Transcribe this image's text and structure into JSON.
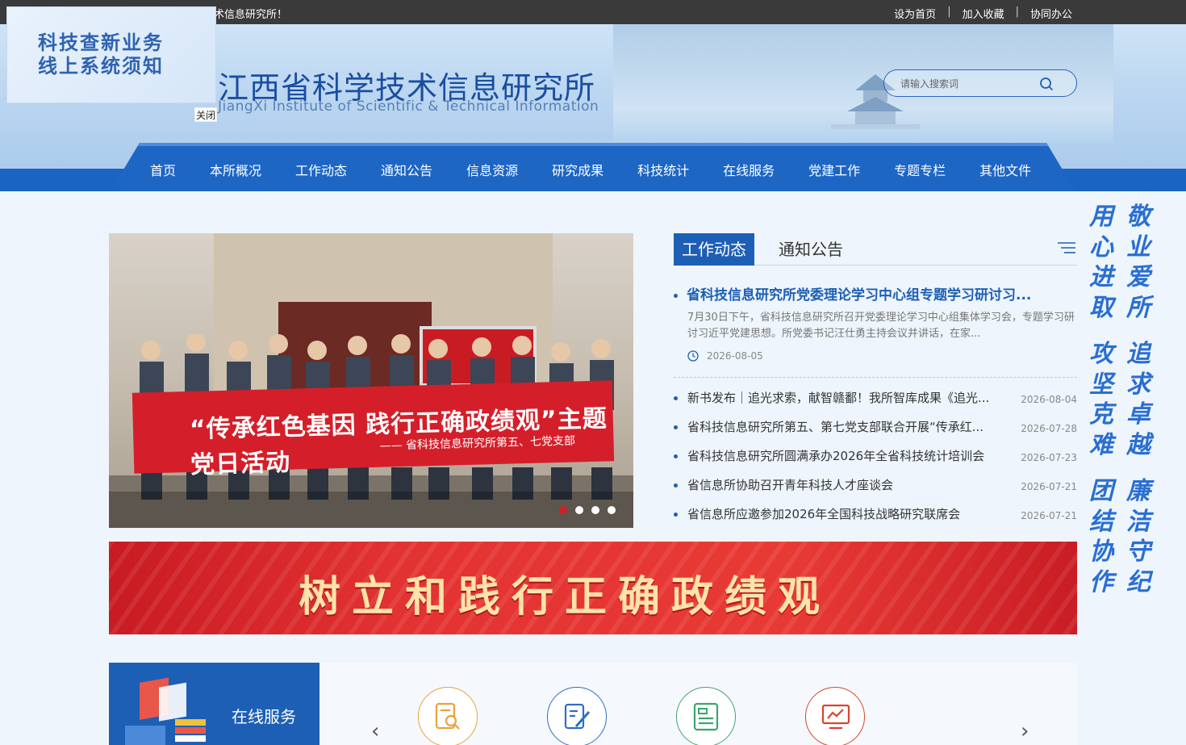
{
  "topbar": {
    "welcome": "术信息研究所！",
    "links": [
      "设为首页",
      "加入收藏",
      "协同办公"
    ],
    "separator": "|"
  },
  "popup": {
    "line1": "科技查新业务",
    "line2": "线上系统须知",
    "close_label": "关闭"
  },
  "header": {
    "title_cn": "江西省科学技术信息研究所",
    "title_en": "JiangXi Institute of Scientific & Technical Information"
  },
  "search": {
    "placeholder": "请输入搜索词"
  },
  "nav": {
    "items": [
      "首页",
      "本所概况",
      "工作动态",
      "通知公告",
      "信息资源",
      "研究成果",
      "科技统计",
      "在线服务",
      "党建工作",
      "专题专栏",
      "其他文件"
    ]
  },
  "slide": {
    "banner_main": "“传承红色基因  践行正确政绩观”主题党日活动",
    "banner_sub": "—— 省科技信息研究所第五、七党支部",
    "dots": 4,
    "active_dot": 0
  },
  "news": {
    "tabs": [
      "工作动态",
      "通知公告"
    ],
    "headline": "省科技信息研究所党委理论学习中心组专题学习研讨习...",
    "summary": "7月30日下午，省科技信息研究所召开党委理论学习中心组集体学习会，专题学习研讨习近平党建思想。所党委书记汪仕勇主持会议并讲话，在家...",
    "headline_date": "2026-08-05",
    "items": [
      {
        "title": "新书发布｜追光求索，献智赣鄱！我所智库成果《追光...",
        "date": "2026-08-04"
      },
      {
        "title": "省科技信息研究所第五、第七党支部联合开展“传承红...",
        "date": "2026-07-28"
      },
      {
        "title": "省科技信息研究所圆满承办2026年全省科技统计培训会",
        "date": "2026-07-23"
      },
      {
        "title": "省信息所协助召开青年科技人才座谈会",
        "date": "2026-07-21"
      },
      {
        "title": "省信息所应邀参加2026年全国科技战略研究联席会",
        "date": "2026-07-21"
      }
    ]
  },
  "slogan": {
    "columns": [
      "用心进取",
      "敬业爱所",
      "攻坚克难",
      "追求卓越",
      "团结协作",
      "廉洁守纪"
    ]
  },
  "big_banner": {
    "text": "树立和践行正确政绩观"
  },
  "online_service": {
    "label": "在线服务",
    "prev": "‹",
    "next": "›",
    "icons": [
      {
        "name": "search-doc-icon",
        "color": "#e8a23a"
      },
      {
        "name": "edit-doc-icon",
        "color": "#2f6dc6"
      },
      {
        "name": "list-doc-icon",
        "color": "#3aa66d"
      },
      {
        "name": "chart-screen-icon",
        "color": "#d8452b"
      }
    ]
  },
  "colors": {
    "primary": "#1d5fb5",
    "accent_red": "#d41f2a",
    "topbar": "#3a3a3a"
  }
}
